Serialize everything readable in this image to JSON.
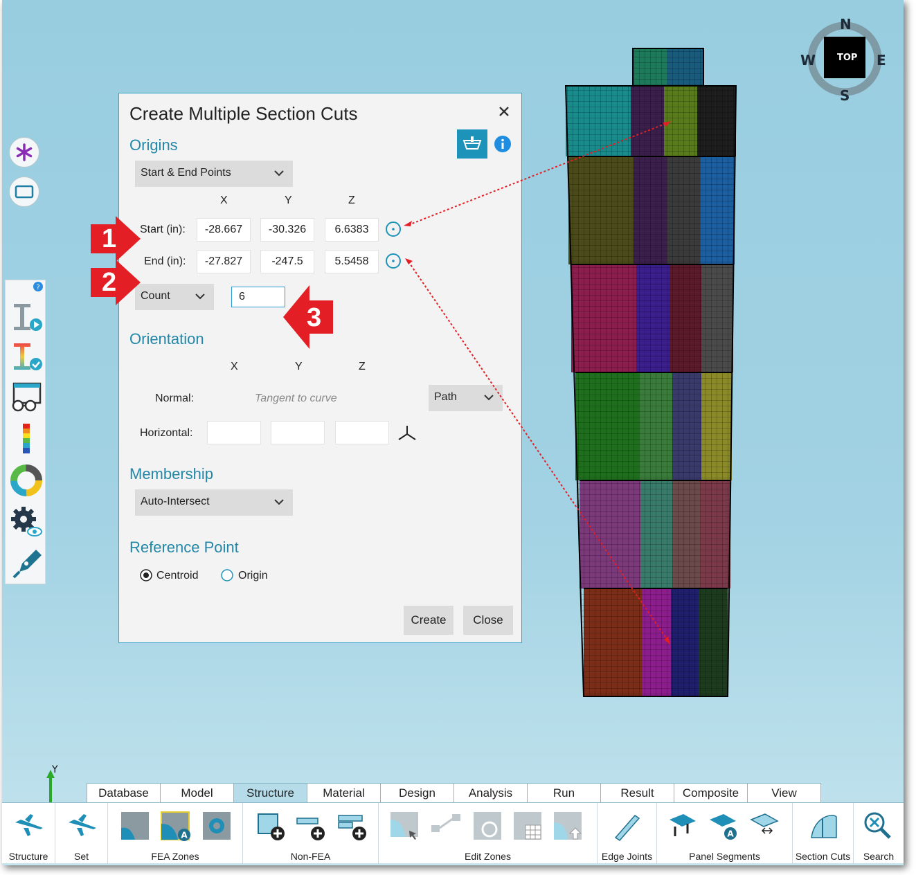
{
  "compass": {
    "north": "N",
    "south": "S",
    "east": "E",
    "west": "W",
    "view": "TOP"
  },
  "dialog": {
    "title": "Create Multiple Section Cuts",
    "origins": {
      "heading": "Origins",
      "mode": "Start & End Points",
      "col_x": "X",
      "col_y": "Y",
      "col_z": "Z",
      "start_label": "Start (in):",
      "start": {
        "x": "-28.667",
        "y": "-30.326",
        "z": "6.6383"
      },
      "end_label": "End (in):",
      "end": {
        "x": "-27.827",
        "y": "-247.5",
        "z": "5.5458"
      },
      "count_mode": "Count",
      "count_value": "6"
    },
    "orientation": {
      "heading": "Orientation",
      "col_x": "X",
      "col_y": "Y",
      "col_z": "Z",
      "normal_label": "Normal:",
      "normal_placeholder": "Tangent to curve",
      "normal_mode": "Path",
      "horizontal_label": "Horizontal:"
    },
    "membership": {
      "heading": "Membership",
      "mode": "Auto-Intersect"
    },
    "reference": {
      "heading": "Reference Point",
      "option1": "Centroid",
      "option2": "Origin",
      "selected": "Centroid"
    },
    "create_label": "Create",
    "close_label": "Close"
  },
  "markers": [
    "1",
    "2",
    "3"
  ],
  "axis_label": "Y",
  "tabs": [
    "Database",
    "Model",
    "Structure",
    "Material",
    "Design",
    "Analysis",
    "Run",
    "Result",
    "Composite",
    "View"
  ],
  "active_tab": "Structure",
  "ribbon": {
    "structure": "Structure",
    "set": "Set",
    "fea_zones": "FEA Zones",
    "non_fea": "Non-FEA",
    "edit_zones": "Edit Zones",
    "edge_joints": "Edge Joints",
    "panel_segments": "Panel Segments",
    "section_cuts": "Section Cuts",
    "search": "Search"
  },
  "colors": {
    "accent": "#2387a8",
    "marker_red": "#e31e24",
    "dialog_border": "#34a5c8"
  }
}
